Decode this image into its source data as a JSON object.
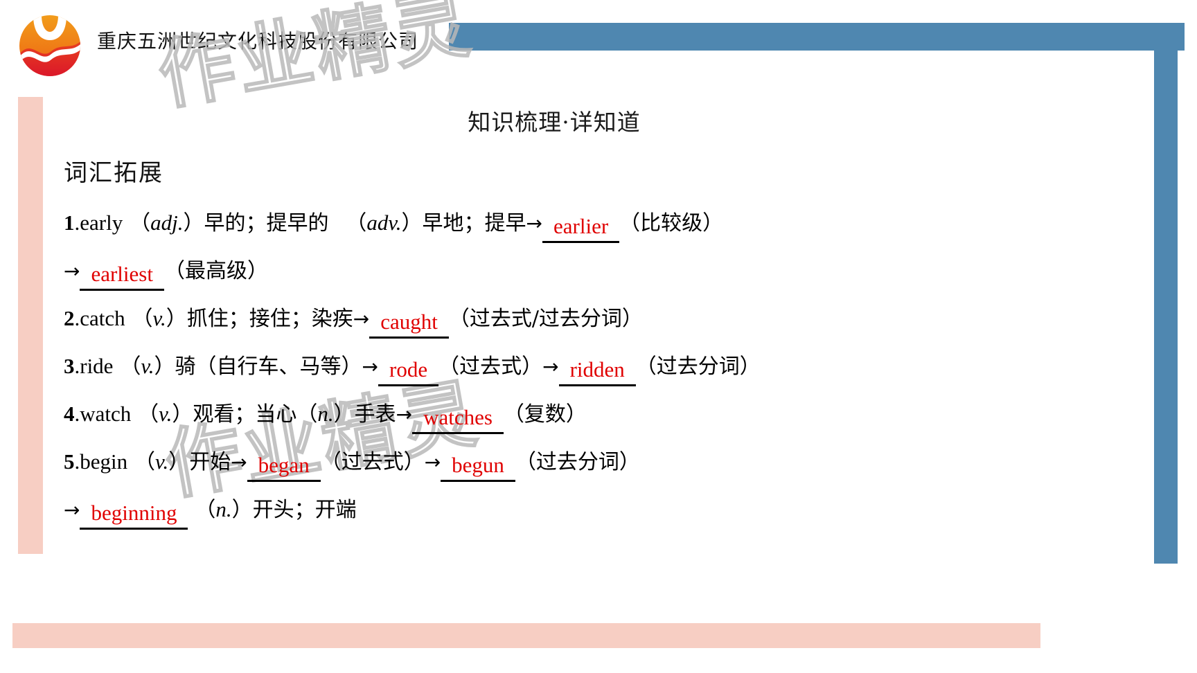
{
  "header": {
    "company_name": "重庆五洲世纪文化科技股份有限公司",
    "logo_name": "wuzhou-logo"
  },
  "watermark": {
    "text_top": "作业精灵",
    "text_bottom": "作业精灵"
  },
  "slide": {
    "title": "知识梳理·详知道",
    "section_heading": "词汇拓展"
  },
  "colors": {
    "accent_blue": "#4f87b0",
    "accent_pink": "#f7cec3",
    "answer_red": "#e00000",
    "logo_orange": "#f08a1e",
    "logo_red": "#e2242c"
  },
  "entries": [
    {
      "num": "1",
      "word": "early",
      "pos1": "adj.",
      "meaning1": "早的；提早的",
      "pos2": "adv.",
      "meaning2": "早地；提早",
      "arrow": "→",
      "answer1": "earlier",
      "note1": "（比较级）",
      "cont_arrow": "→",
      "answer2": "earliest",
      "note2": "（最高级）"
    },
    {
      "num": "2",
      "word": "catch",
      "pos1": "v.",
      "meaning1": "抓住；接住；染疾",
      "arrow": "→",
      "answer1": "caught",
      "note1": "（过去式/过去分词）"
    },
    {
      "num": "3",
      "word": "ride",
      "pos1": "v.",
      "meaning1": "骑（自行车、马等）",
      "arrow": "→",
      "answer1": "rode",
      "note1": "（过去式）",
      "arrow2": "→",
      "answer2": "ridden",
      "note2": "（过去分词）"
    },
    {
      "num": "4",
      "word": "watch",
      "pos1": "v.",
      "meaning1": "观看；当心",
      "pos2": "n.",
      "meaning2": "手表",
      "arrow": "→",
      "answer1": "watches",
      "note1": "（复数）"
    },
    {
      "num": "5",
      "word": "begin",
      "pos1": "v.",
      "meaning1": "开始",
      "arrow": "→",
      "answer1": "began",
      "note1": "（过去式）",
      "arrow2": "→",
      "answer2": "begun",
      "note2": "（过去分词）",
      "cont_arrow": "→",
      "answer3": "beginning",
      "pos3": "n.",
      "meaning3": "开头；开端"
    }
  ]
}
